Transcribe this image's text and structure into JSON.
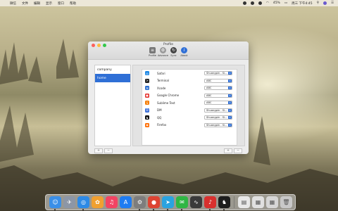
{
  "menubar": {
    "apple": "",
    "items": [
      "微信",
      "文件",
      "编辑",
      "显示",
      "窗口",
      "帮助"
    ],
    "status": {
      "battery": "45%",
      "datetime": "周三 下午4:45"
    }
  },
  "window": {
    "title": "Profile",
    "tabs": [
      {
        "label": "Profile",
        "glyph": "≡"
      },
      {
        "label": "Advance",
        "glyph": "⚙"
      },
      {
        "label": "Sync",
        "glyph": "↻"
      },
      {
        "label": "About",
        "glyph": "i"
      }
    ],
    "sidebar": {
      "items": [
        {
          "label": "company",
          "selected": false
        },
        {
          "label": "home",
          "selected": true
        }
      ],
      "add": "+",
      "remove": "−"
    },
    "apps": [
      {
        "name": "Safari",
        "value": "Shuangpin - Si...",
        "icon": "safari-icon",
        "color": "#1e88e5",
        "glyph": "◎"
      },
      {
        "name": "Terminal",
        "value": "ABC",
        "icon": "terminal-icon",
        "color": "#222222",
        "glyph": ">"
      },
      {
        "name": "Xcode",
        "value": "ABC",
        "icon": "xcode-icon",
        "color": "#2b6ecf",
        "glyph": "⚒"
      },
      {
        "name": "Google Chrome",
        "value": "ABC",
        "icon": "chrome-icon",
        "color": "#e53935",
        "glyph": "●"
      },
      {
        "name": "Sublime Text",
        "value": "ABC",
        "icon": "sublime-icon",
        "color": "#f57c00",
        "glyph": "S"
      },
      {
        "name": "DM",
        "value": "Shuangpin - Si...",
        "icon": "dm-icon",
        "color": "#3c6fd8",
        "glyph": "D"
      },
      {
        "name": "QQ",
        "value": "Shuangpin - Si...",
        "icon": "qq-icon",
        "color": "#111111",
        "glyph": "♞"
      },
      {
        "name": "Firefox",
        "value": "Shuangpin - Si...",
        "icon": "firefox-icon",
        "color": "#ff6d00",
        "glyph": "◉"
      }
    ],
    "main_add": "+",
    "main_remove": "−"
  },
  "dock": {
    "apps": [
      {
        "name": "finder-icon",
        "color": "#3a8fe8",
        "glyph": "☺",
        "running": true
      },
      {
        "name": "launchpad-icon",
        "color": "#8c96a6",
        "glyph": "✈",
        "running": false
      },
      {
        "name": "safari-icon",
        "color": "#2d8ae6",
        "glyph": "◎",
        "running": true
      },
      {
        "name": "photos-icon",
        "color": "#f0a030",
        "glyph": "✿",
        "running": false
      },
      {
        "name": "music-icon",
        "color": "#f24463",
        "glyph": "♫",
        "running": false
      },
      {
        "name": "app-store-icon",
        "color": "#1e7cf2",
        "glyph": "A",
        "running": false
      },
      {
        "name": "system-preferences-icon",
        "color": "#7d7d7d",
        "glyph": "⚙",
        "running": true
      },
      {
        "name": "chrome-icon",
        "color": "#dd4433",
        "glyph": "●",
        "running": true
      },
      {
        "name": "telegram-icon",
        "color": "#2aa3e0",
        "glyph": "➤",
        "running": true
      },
      {
        "name": "wechat-icon",
        "color": "#2fb643",
        "glyph": "✉",
        "running": true
      },
      {
        "name": "activity-monitor-icon",
        "color": "#3a3a3a",
        "glyph": "∿",
        "running": false
      },
      {
        "name": "netease-music-icon",
        "color": "#d8302e",
        "glyph": "♪",
        "running": true
      },
      {
        "name": "qq-icon",
        "color": "#1d1d1d",
        "glyph": "♞",
        "running": true
      },
      {
        "name": "document-icon",
        "color": "#e8e8e8",
        "glyph": "▤",
        "running": false
      },
      {
        "name": "preview-icon",
        "color": "#e0e0e0",
        "glyph": "▦",
        "running": false
      },
      {
        "name": "downloads-icon",
        "color": "#d6d6d6",
        "glyph": "▦",
        "running": false
      },
      {
        "name": "trash-icon",
        "color": "#c8c8c8",
        "glyph": "🗑",
        "running": false
      }
    ]
  }
}
